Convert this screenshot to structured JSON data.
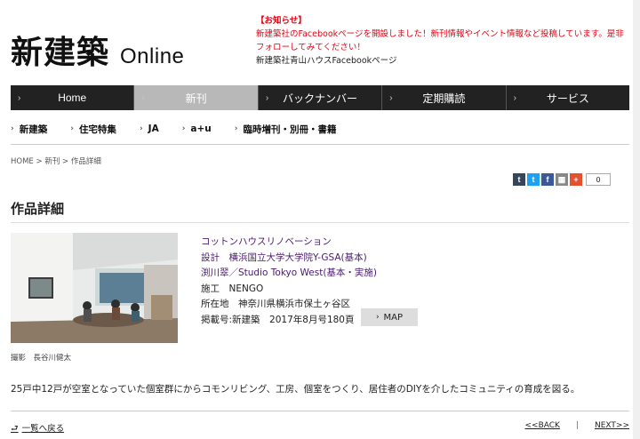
{
  "header": {
    "logo_jp": "新建築",
    "logo_en": "Online",
    "notice_title": "【お知らせ】",
    "notice_body": "新建築社のFacebookページを開設しました！新刊情報やイベント情報など投稿しています。是非フォローしてみてください！",
    "notice_link": "新建築社青山ハウスFacebookページ"
  },
  "global_nav": [
    {
      "label": "Home"
    },
    {
      "label": "新刊"
    },
    {
      "label": "バックナンバー"
    },
    {
      "label": "定期購読"
    },
    {
      "label": "サービス"
    }
  ],
  "sub_nav": [
    {
      "label": "新建築"
    },
    {
      "label": "住宅特集"
    },
    {
      "label": "JA"
    },
    {
      "label": "a+u"
    },
    {
      "label": "臨時増刊・別冊・書籍"
    }
  ],
  "breadcrumb": {
    "home": "HOME",
    "sep1": " > ",
    "new": "新刊",
    "sep2": " > ",
    "current": "作品詳細"
  },
  "share": {
    "buttons": [
      {
        "glyph": "t",
        "color": "#35465c"
      },
      {
        "glyph": "t",
        "color": "#1da1f2"
      },
      {
        "glyph": "f",
        "color": "#3b5998"
      },
      {
        "glyph": "▦",
        "color": "#888888"
      },
      {
        "glyph": "+",
        "color": "#e5502f"
      }
    ],
    "count": "0"
  },
  "page_title": "作品詳細",
  "work": {
    "title": "コットンハウスリノベーション",
    "design_line1": "設計　横浜国立大学大学院Y-GSA(基本)",
    "design_line2": "渕川翠／Studio Tokyo West(基本・実施)",
    "construction": "施工　NENGO",
    "location": "所在地　神奈川県横浜市保土ヶ谷区",
    "published": "掲載号:新建築　2017年8月号180頁",
    "map_label": "MAP",
    "photo_credit": "撮影　長谷川健太",
    "description": "25戸中12戸が空室となっていた個室群にからコモンリビング、工房、個室をつくり、居住者のDIYを介したコミュニティの育成を図る。"
  },
  "footer": {
    "back_label": "一覧へ戻る",
    "prev_label": "<<BACK",
    "next_label": "NEXT>>"
  }
}
